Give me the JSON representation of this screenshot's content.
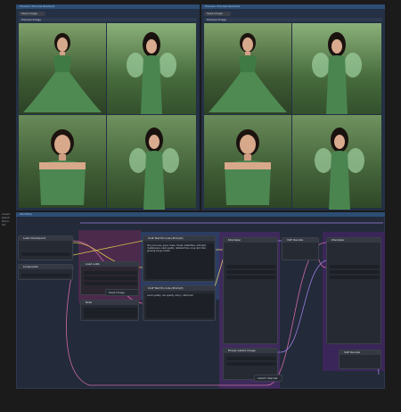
{
  "groups": {
    "left_preview": "Preview: Preview Realvisxl",
    "right_preview": "Preview: Preview Realvisxl",
    "workflow": "Workflow"
  },
  "preview_left": {
    "save_label": "Save Image",
    "node_label": "Preview Image"
  },
  "preview_right": {
    "save_label": "Save Image",
    "node_label": "Preview Image"
  },
  "nodes": {
    "load_checkpoint": "Load Checkpoint",
    "lora": "LoraLoader",
    "lora2": "Load LoRA",
    "clip_pos": "CLIP Text Encode (Prompt)",
    "clip_neg": "CLIP Text Encode (Prompt)",
    "ksampler1": "KSampler",
    "ksampler2": "KSampler",
    "vae_decode1": "VAE Decode",
    "vae_decode2": "VAE Decode",
    "empty_latent": "Empty Latent Image",
    "note": "Note",
    "save_image": "Save Image",
    "latent_upscale": "Latent Upscale"
  },
  "prompt_text": "fairy princess, green dress, forest, butterflies, soft light, masterpiece, best quality, detailed face, long dark hair, glowing wings, bokeh",
  "neg_prompt_text": "worst quality, low quality, blurry, deformed",
  "side_labels": [
    "Lorem",
    "Ipsum",
    "Dolor",
    "Sit"
  ],
  "colors": {
    "group_header": "#2d4d73",
    "lora_group": "#5b2d5a",
    "ksampler_group": "#4a2a66",
    "wire_pink": "#d06aa8",
    "wire_yellow": "#d8c04a",
    "wire_purple": "#9b7fe0",
    "forest_green": "#4b6b3e",
    "dress_green": "#4e8a52"
  }
}
